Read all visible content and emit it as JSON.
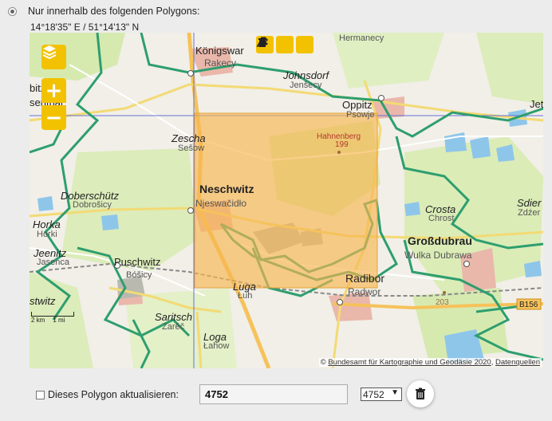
{
  "option": {
    "label": "Nur innerhalb des folgenden Polygons:"
  },
  "coordinate_readout": "14°18'35\" E / 51°14'13\" N",
  "map": {
    "places": [
      {
        "id": "koenigswartha",
        "name": "Königswar",
        "sub": "Rakecy"
      },
      {
        "id": "hermsdorf",
        "name": "",
        "sub": "Hermanecy"
      },
      {
        "id": "johnsdorf",
        "name": "Johnsdorf",
        "sub": "Jenšecy"
      },
      {
        "id": "oppitz",
        "name": "Oppitz",
        "sub": "Psowje"
      },
      {
        "id": "jet",
        "name": "Jet",
        "sub": ""
      },
      {
        "id": "zescha",
        "name": "Zescha",
        "sub": "Sešow"
      },
      {
        "id": "hahnenberg",
        "name": "Hahnenberg",
        "sub": "199"
      },
      {
        "id": "neschwitz",
        "name": "Neschwitz",
        "sub": "Njeswačidło"
      },
      {
        "id": "doberschuetz",
        "name": "Doberschütz",
        "sub": "Dobrošicy"
      },
      {
        "id": "horka",
        "name": "Horka",
        "sub": "Hórki"
      },
      {
        "id": "crosta",
        "name": "Crosta",
        "sub": "Chrost"
      },
      {
        "id": "sdier",
        "name": "Sdier",
        "sub": "Zdźer"
      },
      {
        "id": "grossdubrau",
        "name": "Großdubrau",
        "sub": "Wulka Dubrawa"
      },
      {
        "id": "jeenitz",
        "name": "Jeenitz",
        "sub": "Jasenca"
      },
      {
        "id": "puschwitz",
        "name": "Puschwitz",
        "sub": "Bóšicy"
      },
      {
        "id": "radibor",
        "name": "Radibor",
        "sub": "Radwor"
      },
      {
        "id": "luga",
        "name": "Luga",
        "sub": "Łuh"
      },
      {
        "id": "stwitz",
        "name": "stwitz",
        "sub": ""
      },
      {
        "id": "saritsch",
        "name": "Saritsch",
        "sub": "Zarěč"
      },
      {
        "id": "loga",
        "name": "Loga",
        "sub": "Łahow"
      },
      {
        "id": "bitsenthal",
        "name": "bitz",
        "sub": "senthal"
      }
    ],
    "elevation_203": "203",
    "road_b156": "B156",
    "scale": {
      "km": "2 km",
      "mi": "1 mi"
    },
    "attribution": {
      "copyright": "© ",
      "link1": "Bundesamt für Kartographie und Geodäsie 2020",
      "separator": ", ",
      "link2": "Datenquellen"
    },
    "controls": {
      "layers_icon": "layers-icon",
      "zoom_in": "+",
      "zoom_out": "−",
      "tools": [
        "draw-polygon-icon",
        "edit-polygon-icon",
        "delete-polygon-icon"
      ]
    }
  },
  "update": {
    "checkbox_label": "Dieses Polygon aktualisieren:",
    "checkbox_checked": false,
    "polygon_name": "4752",
    "select_value": "4752",
    "delete_icon": "trash-icon"
  }
}
